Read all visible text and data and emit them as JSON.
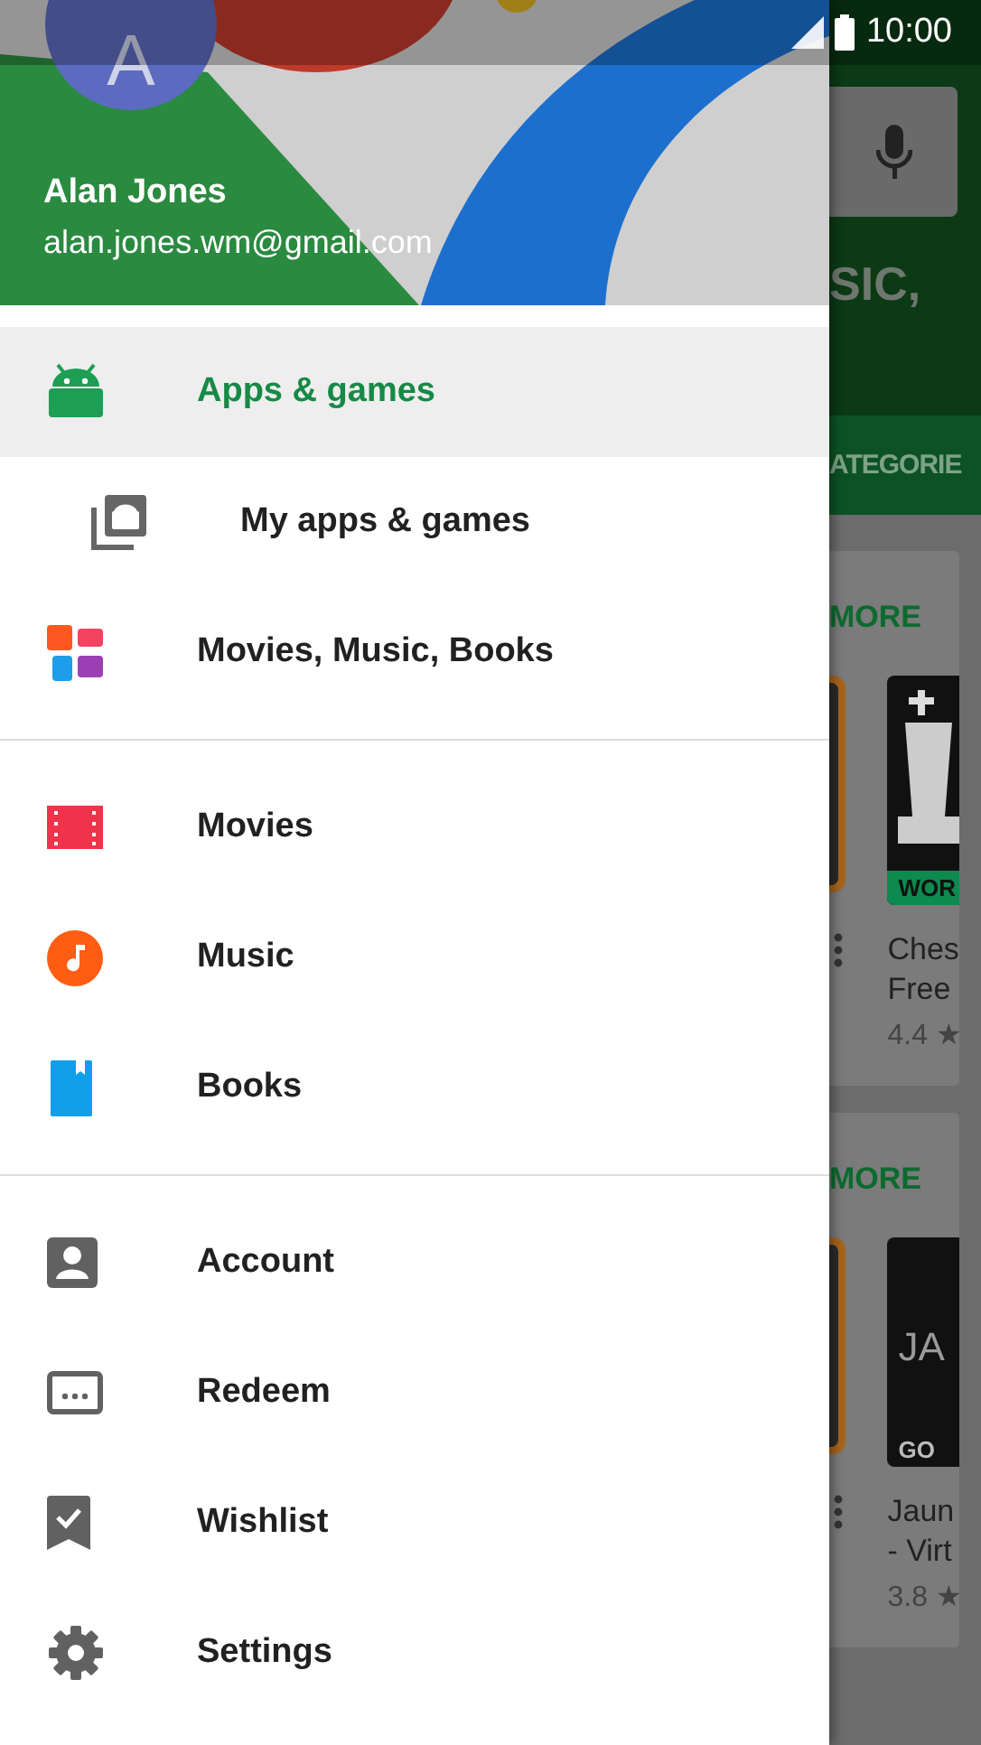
{
  "status_bar": {
    "time": "10:00"
  },
  "account": {
    "avatar_letter": "A",
    "name": "Alan Jones",
    "email": "alan.jones.wm@gmail.com"
  },
  "menu_sections": [
    {
      "items": [
        {
          "label": "Apps & games",
          "selected": true,
          "children": [
            {
              "label": "My apps & games",
              "selected": false
            }
          ]
        },
        {
          "label": "Movies, Music, Books",
          "selected": false
        }
      ]
    },
    {
      "items": [
        {
          "label": "Movies",
          "selected": false
        },
        {
          "label": "Music",
          "selected": false
        },
        {
          "label": "Books",
          "selected": false
        }
      ]
    },
    {
      "items": [
        {
          "label": "Account",
          "selected": false
        },
        {
          "label": "Redeem",
          "selected": false
        },
        {
          "label": "Wishlist",
          "selected": false
        },
        {
          "label": "Settings",
          "selected": false
        }
      ]
    }
  ],
  "background_app": {
    "search_tail": "SIC,",
    "tab": "ATEGORIE",
    "cards": [
      {
        "more": "MORE",
        "icon_texts": [
          "WOR"
        ],
        "title_lines": [
          "Ches",
          "Free"
        ],
        "rating": "4.4",
        "star": "★"
      },
      {
        "more": "MORE",
        "icon_texts": [
          "JA",
          "GO"
        ],
        "title_lines": [
          "Jaun",
          "- Virt"
        ],
        "rating": "3.8",
        "star": "★"
      }
    ]
  }
}
